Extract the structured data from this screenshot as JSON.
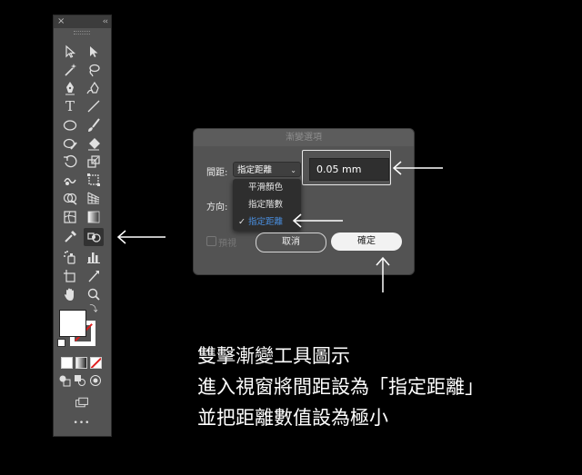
{
  "toolbar": {
    "close_glyph": "×",
    "collapse_glyph": "‹‹",
    "tools": [
      {
        "name": "selection-tool-icon"
      },
      {
        "name": "direct-selection-tool-icon"
      },
      {
        "name": "magic-wand-tool-icon"
      },
      {
        "name": "lasso-tool-icon"
      },
      {
        "name": "pen-tool-icon"
      },
      {
        "name": "curvature-tool-icon"
      },
      {
        "name": "type-tool-icon",
        "glyph": "T"
      },
      {
        "name": "line-segment-tool-icon"
      },
      {
        "name": "ellipse-tool-icon"
      },
      {
        "name": "paintbrush-tool-icon"
      },
      {
        "name": "shaper-tool-icon"
      },
      {
        "name": "eraser-tool-icon"
      },
      {
        "name": "rotate-tool-icon"
      },
      {
        "name": "scale-tool-icon"
      },
      {
        "name": "warp-tool-icon"
      },
      {
        "name": "free-transform-tool-icon"
      },
      {
        "name": "shape-builder-tool-icon"
      },
      {
        "name": "perspective-grid-tool-icon"
      },
      {
        "name": "mesh-tool-icon"
      },
      {
        "name": "gradient-tool-icon"
      },
      {
        "name": "eyedropper-tool-icon"
      },
      {
        "name": "blend-tool-icon"
      },
      {
        "name": "symbol-sprayer-tool-icon"
      },
      {
        "name": "column-graph-tool-icon"
      },
      {
        "name": "artboard-tool-icon"
      },
      {
        "name": "slice-tool-icon"
      },
      {
        "name": "hand-tool-icon"
      },
      {
        "name": "zoom-tool-icon"
      }
    ],
    "active_tool": "blend-tool-icon",
    "more_glyph": "•••"
  },
  "dialog": {
    "title": "漸變選項",
    "spacing_label": "間距:",
    "spacing_selected": "指定距離",
    "spacing_value": "0.05 mm",
    "orientation_label": "方向:",
    "menu_items": [
      "平滑顏色",
      "指定階數",
      "指定距離"
    ],
    "menu_selected": "指定距離",
    "check_glyph": "✓",
    "preview_label": "預視",
    "cancel_label": "取消",
    "ok_label": "確定"
  },
  "caption": {
    "line1": "雙擊漸變工具圖示",
    "line2": "進入視窗將間距設為「指定距離」",
    "line3": "並把距離數值設為極小"
  },
  "colors": {
    "background": "#000000",
    "panel": "#535353",
    "accent_blue": "#4a90e2",
    "stroke_red": "#e02020"
  }
}
